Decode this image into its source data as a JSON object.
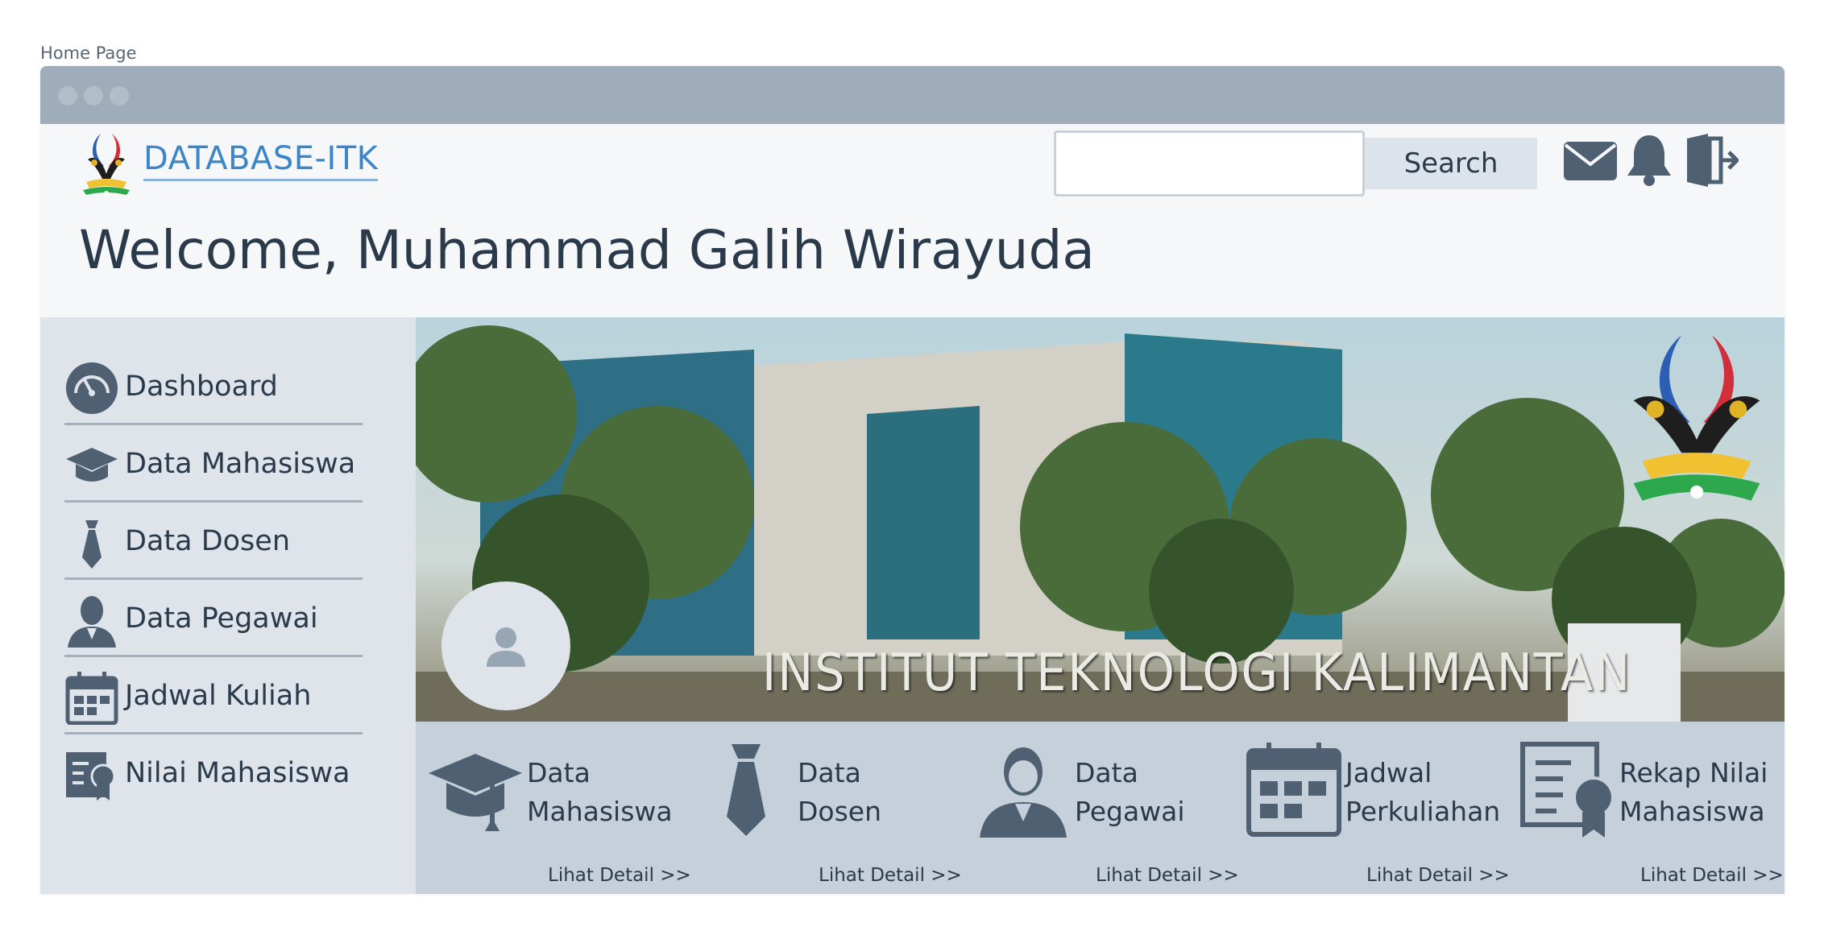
{
  "page_label": "Home Page",
  "header": {
    "brand": "DATABASE-ITK",
    "search_placeholder": "",
    "search_button": "Search",
    "welcome": "Welcome, Muhammad Galih Wirayuda"
  },
  "icons": {
    "mail": "envelope-icon",
    "notifications": "bell-icon",
    "logout": "door-exit-icon"
  },
  "sidebar": {
    "items": [
      {
        "label": "Dashboard",
        "icon": "speedometer-icon"
      },
      {
        "label": "Data Mahasiswa",
        "icon": "graduation-cap-icon"
      },
      {
        "label": "Data Dosen",
        "icon": "necktie-icon"
      },
      {
        "label": "Data Pegawai",
        "icon": "employee-icon"
      },
      {
        "label": "Jadwal Kuliah",
        "icon": "calendar-icon"
      },
      {
        "label": "Nilai Mahasiswa",
        "icon": "certificate-icon"
      }
    ]
  },
  "hero": {
    "sign_text": "INSTITUT TEKNOLOGI KALIMANTAN"
  },
  "cards": [
    {
      "title": "Data\nMahasiswa",
      "link": "Lihat Detail >>",
      "icon": "graduation-cap-icon"
    },
    {
      "title": "Data\nDosen",
      "link": "Lihat Detail >>",
      "icon": "necktie-icon"
    },
    {
      "title": "Data\nPegawai",
      "link": "Lihat Detail >>",
      "icon": "employee-icon"
    },
    {
      "title": "Jadwal\nPerkuliahan",
      "link": "Lihat Detail >>",
      "icon": "calendar-icon"
    },
    {
      "title": "Rekap Nilai\nMahasiswa",
      "link": "Lihat Detail >>",
      "icon": "certificate-icon"
    }
  ],
  "colors": {
    "icon": "#4f6072",
    "brand": "#3a86c8",
    "titlebar": "#9eadb9",
    "sidebar": "#dfe4eb",
    "cards": "#c5d0db"
  }
}
